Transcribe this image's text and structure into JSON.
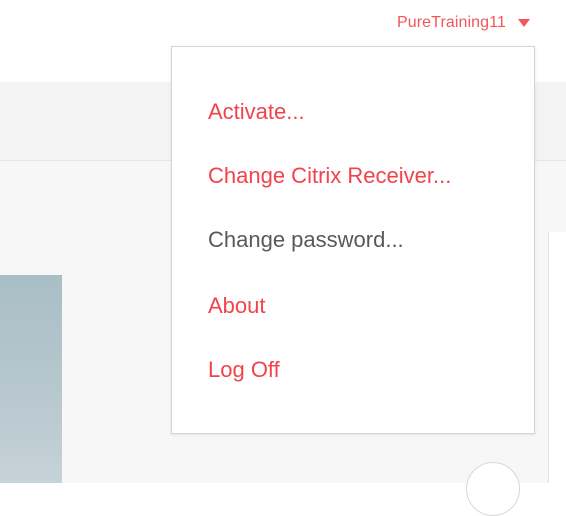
{
  "header": {
    "username": "PureTraining11",
    "caret_icon": "caret-down-icon"
  },
  "menu": {
    "items": [
      {
        "label": "Activate...",
        "style": "accent"
      },
      {
        "label": "Change Citrix Receiver...",
        "style": "accent"
      },
      {
        "label": "Change password...",
        "style": "muted"
      },
      {
        "label": "About",
        "style": "accent"
      },
      {
        "label": "Log Off",
        "style": "accent"
      }
    ]
  },
  "colors": {
    "accent": "#f2434b",
    "muted": "#595959",
    "panel": "#a9bec6"
  }
}
